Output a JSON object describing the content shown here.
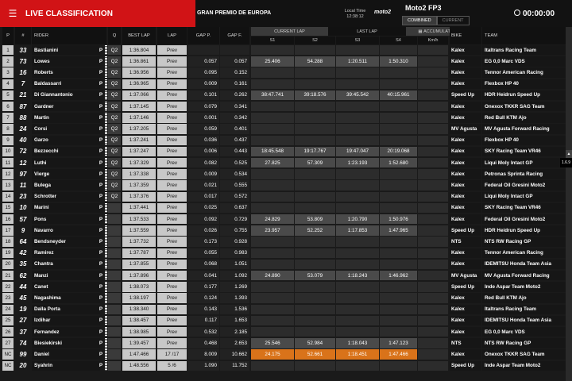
{
  "header": {
    "title": "LIVE CLASSIFICATION",
    "event": "GRAN PREMIO DE EUROPA",
    "local_time_label": "Local Time",
    "local_time": "12:38:12",
    "logo": "moto2",
    "session": "Moto2 FP3",
    "seg_combined": "COMBINED",
    "seg_current": "CURRENT",
    "clock": "00:00:00"
  },
  "columns": {
    "p": "P",
    "num": "#",
    "rider": "RIDER",
    "q": "Q",
    "best": "BEST LAP",
    "lap": "LAP",
    "gapp": "GAP P.",
    "gapf": "GAP F.",
    "current_lap": "CURRENT LAP",
    "last_lap": "LAST LAP",
    "accumulated": "ACCUMULATED",
    "s1": "S1",
    "s2": "S2",
    "s3": "S3",
    "s4": "S4",
    "kmh": "Km/h",
    "bike": "BIKE",
    "team": "TEAM"
  },
  "version": "1.6.9",
  "rows": [
    {
      "pos": "1",
      "num": "33",
      "rider": "Bastianini",
      "flag": "P",
      "q": "Q2",
      "best": "1:36.804",
      "lap": "Prev",
      "gapp": "",
      "gapf": "",
      "s1": "",
      "s2": "",
      "s3": "",
      "s4": "",
      "bike": "Kalex",
      "team": "Italtrans Racing Team",
      "style": ""
    },
    {
      "pos": "2",
      "num": "73",
      "rider": "Lowes",
      "flag": "P",
      "q": "Q2",
      "best": "1:36.861",
      "lap": "Prev",
      "gapp": "0.057",
      "gapf": "0.057",
      "s1": "25.406",
      "s2": "54.288",
      "s3": "1:20.511",
      "s4": "1:50.310",
      "bike": "Kalex",
      "team": "EG 0,0 Marc VDS",
      "style": "hl"
    },
    {
      "pos": "3",
      "num": "16",
      "rider": "Roberts",
      "flag": "P",
      "q": "Q2",
      "best": "1:36.956",
      "lap": "Prev",
      "gapp": "0.095",
      "gapf": "0.152",
      "s1": "",
      "s2": "",
      "s3": "",
      "s4": "",
      "bike": "Kalex",
      "team": "Tennor American Racing",
      "style": ""
    },
    {
      "pos": "4",
      "num": "7",
      "rider": "Baldassarri",
      "flag": "P",
      "q": "Q2",
      "best": "1:36.965",
      "lap": "Prev",
      "gapp": "0.009",
      "gapf": "0.161",
      "s1": "",
      "s2": "",
      "s3": "",
      "s4": "",
      "bike": "Kalex",
      "team": "Flexbox HP 40",
      "style": ""
    },
    {
      "pos": "5",
      "num": "21",
      "rider": "Di Giannantonio",
      "flag": "P",
      "q": "Q2",
      "best": "1:37.066",
      "lap": "Prev",
      "gapp": "0.101",
      "gapf": "0.262",
      "s1": "38:47.741",
      "s2": "39:18.576",
      "s3": "39:45.542",
      "s4": "40:15.961",
      "bike": "Speed Up",
      "team": "HDR Heidrun Speed Up",
      "style": "hl"
    },
    {
      "pos": "6",
      "num": "87",
      "rider": "Gardner",
      "flag": "P",
      "q": "Q2",
      "best": "1:37.145",
      "lap": "Prev",
      "gapp": "0.079",
      "gapf": "0.341",
      "s1": "",
      "s2": "",
      "s3": "",
      "s4": "",
      "bike": "Kalex",
      "team": "Onexox TKKR SAG Team",
      "style": ""
    },
    {
      "pos": "7",
      "num": "88",
      "rider": "Martin",
      "flag": "P",
      "q": "Q2",
      "best": "1:37.146",
      "lap": "Prev",
      "gapp": "0.001",
      "gapf": "0.342",
      "s1": "",
      "s2": "",
      "s3": "",
      "s4": "",
      "bike": "Kalex",
      "team": "Red Bull KTM Ajo",
      "style": ""
    },
    {
      "pos": "8",
      "num": "24",
      "rider": "Corsi",
      "flag": "P",
      "q": "Q2",
      "best": "1:37.205",
      "lap": "Prev",
      "gapp": "0.059",
      "gapf": "0.401",
      "s1": "",
      "s2": "",
      "s3": "",
      "s4": "",
      "bike": "MV Agusta",
      "team": "MV Agusta Forward Racing",
      "style": ""
    },
    {
      "pos": "9",
      "num": "40",
      "rider": "Garzo",
      "flag": "P",
      "q": "Q2",
      "best": "1:37.241",
      "lap": "Prev",
      "gapp": "0.036",
      "gapf": "0.437",
      "s1": "",
      "s2": "",
      "s3": "",
      "s4": "",
      "bike": "Kalex",
      "team": "Flexbox HP 40",
      "style": ""
    },
    {
      "pos": "10",
      "num": "72",
      "rider": "Bezzecchi",
      "flag": "P",
      "q": "Q2",
      "best": "1:37.247",
      "lap": "Prev",
      "gapp": "0.006",
      "gapf": "0.443",
      "s1": "18:45.548",
      "s2": "19:17.767",
      "s3": "19:47.047",
      "s4": "20:19.068",
      "bike": "Kalex",
      "team": "SKY Racing Team VR46",
      "style": "hl"
    },
    {
      "pos": "11",
      "num": "12",
      "rider": "Luthi",
      "flag": "P",
      "q": "Q2",
      "best": "1:37.329",
      "lap": "Prev",
      "gapp": "0.082",
      "gapf": "0.525",
      "s1": "27.825",
      "s2": "57.309",
      "s3": "1:23.193",
      "s4": "1:52.680",
      "bike": "Kalex",
      "team": "Liqui Moly Intact GP",
      "style": "hl"
    },
    {
      "pos": "12",
      "num": "97",
      "rider": "Vierge",
      "flag": "P",
      "q": "Q2",
      "best": "1:37.338",
      "lap": "Prev",
      "gapp": "0.009",
      "gapf": "0.534",
      "s1": "",
      "s2": "",
      "s3": "",
      "s4": "",
      "bike": "Kalex",
      "team": "Petronas Sprinta Racing",
      "style": ""
    },
    {
      "pos": "13",
      "num": "11",
      "rider": "Bulega",
      "flag": "P",
      "q": "Q2",
      "best": "1:37.359",
      "lap": "Prev",
      "gapp": "0.021",
      "gapf": "0.555",
      "s1": "",
      "s2": "",
      "s3": "",
      "s4": "",
      "bike": "Kalex",
      "team": "Federal Oil Gresini Moto2",
      "style": ""
    },
    {
      "pos": "14",
      "num": "23",
      "rider": "Schrotter",
      "flag": "P",
      "q": "Q2",
      "best": "1:37.376",
      "lap": "Prev",
      "gapp": "0.017",
      "gapf": "0.572",
      "s1": "",
      "s2": "",
      "s3": "",
      "s4": "",
      "bike": "Kalex",
      "team": "Liqui Moly Intact GP",
      "style": ""
    },
    {
      "pos": "15",
      "num": "10",
      "rider": "Marini",
      "flag": "P",
      "q": "",
      "best": "1:37.441",
      "lap": "Prev",
      "gapp": "0.025",
      "gapf": "0.637",
      "s1": "",
      "s2": "",
      "s3": "",
      "s4": "",
      "bike": "Kalex",
      "team": "SKY Racing Team VR46",
      "style": ""
    },
    {
      "pos": "16",
      "num": "57",
      "rider": "Pons",
      "flag": "P",
      "q": "",
      "best": "1:37.533",
      "lap": "Prev",
      "gapp": "0.092",
      "gapf": "0.729",
      "s1": "24.829",
      "s2": "53.809",
      "s3": "1:20.790",
      "s4": "1:50.976",
      "bike": "Kalex",
      "team": "Federal Oil Gresini Moto2",
      "style": "hl"
    },
    {
      "pos": "17",
      "num": "9",
      "rider": "Navarro",
      "flag": "P",
      "q": "",
      "best": "1:37.559",
      "lap": "Prev",
      "gapp": "0.026",
      "gapf": "0.755",
      "s1": "23.957",
      "s2": "52.252",
      "s3": "1:17.853",
      "s4": "1:47.965",
      "bike": "Speed Up",
      "team": "HDR Heidrun Speed Up",
      "style": "hl"
    },
    {
      "pos": "18",
      "num": "64",
      "rider": "Bendsneyder",
      "flag": "P",
      "q": "",
      "best": "1:37.732",
      "lap": "Prev",
      "gapp": "0.173",
      "gapf": "0.928",
      "s1": "",
      "s2": "",
      "s3": "",
      "s4": "",
      "bike": "NTS",
      "team": "NTS RW Racing GP",
      "style": ""
    },
    {
      "pos": "19",
      "num": "42",
      "rider": "Ramirez",
      "flag": "P",
      "q": "",
      "best": "1:37.787",
      "lap": "Prev",
      "gapp": "0.055",
      "gapf": "0.983",
      "s1": "",
      "s2": "",
      "s3": "",
      "s4": "",
      "bike": "Kalex",
      "team": "Tennor American Racing",
      "style": ""
    },
    {
      "pos": "20",
      "num": "35",
      "rider": "Chantra",
      "flag": "P",
      "q": "",
      "best": "1:37.855",
      "lap": "Prev",
      "gapp": "0.068",
      "gapf": "1.051",
      "s1": "",
      "s2": "",
      "s3": "",
      "s4": "",
      "bike": "Kalex",
      "team": "IDEMITSU Honda Team Asia",
      "style": ""
    },
    {
      "pos": "21",
      "num": "62",
      "rider": "Manzi",
      "flag": "P",
      "q": "",
      "best": "1:37.896",
      "lap": "Prev",
      "gapp": "0.041",
      "gapf": "1.092",
      "s1": "24.890",
      "s2": "53.079",
      "s3": "1:18.243",
      "s4": "1:46.962",
      "bike": "MV Agusta",
      "team": "MV Agusta Forward Racing",
      "style": "hl"
    },
    {
      "pos": "22",
      "num": "44",
      "rider": "Canet",
      "flag": "P",
      "q": "",
      "best": "1:38.073",
      "lap": "Prev",
      "gapp": "0.177",
      "gapf": "1.269",
      "s1": "",
      "s2": "",
      "s3": "",
      "s4": "",
      "bike": "Speed Up",
      "team": "Inde Aspar Team Moto2",
      "style": ""
    },
    {
      "pos": "23",
      "num": "45",
      "rider": "Nagashima",
      "flag": "P",
      "q": "",
      "best": "1:38.197",
      "lap": "Prev",
      "gapp": "0.124",
      "gapf": "1.393",
      "s1": "",
      "s2": "",
      "s3": "",
      "s4": "",
      "bike": "Kalex",
      "team": "Red Bull KTM Ajo",
      "style": ""
    },
    {
      "pos": "24",
      "num": "19",
      "rider": "Dalla Porta",
      "flag": "P",
      "q": "",
      "best": "1:38.340",
      "lap": "Prev",
      "gapp": "0.143",
      "gapf": "1.536",
      "s1": "",
      "s2": "",
      "s3": "",
      "s4": "",
      "bike": "Kalex",
      "team": "Italtrans Racing Team",
      "style": ""
    },
    {
      "pos": "25",
      "num": "27",
      "rider": "Izdihar",
      "flag": "P",
      "q": "",
      "best": "1:38.457",
      "lap": "Prev",
      "gapp": "0.117",
      "gapf": "1.653",
      "s1": "",
      "s2": "",
      "s3": "",
      "s4": "",
      "bike": "Kalex",
      "team": "IDEMITSU Honda Team Asia",
      "style": ""
    },
    {
      "pos": "26",
      "num": "37",
      "rider": "Fernandez",
      "flag": "P",
      "q": "",
      "best": "1:38.985",
      "lap": "Prev",
      "gapp": "0.532",
      "gapf": "2.185",
      "s1": "",
      "s2": "",
      "s3": "",
      "s4": "",
      "bike": "Kalex",
      "team": "EG 0,0 Marc VDS",
      "style": ""
    },
    {
      "pos": "27",
      "num": "74",
      "rider": "Biesiekirski",
      "flag": "P",
      "q": "",
      "best": "1:39.457",
      "lap": "Prev",
      "gapp": "0.468",
      "gapf": "2.653",
      "s1": "25.546",
      "s2": "52.984",
      "s3": "1:18.043",
      "s4": "1:47.123",
      "bike": "NTS",
      "team": "NTS RW Racing GP",
      "style": "hl"
    },
    {
      "pos": "NC",
      "num": "99",
      "rider": "Daniel",
      "flag": "P",
      "q": "",
      "best": "1:47.466",
      "lap": "17 /17",
      "gapp": "8.009",
      "gapf": "10.662",
      "s1": "24.175",
      "s2": "52.661",
      "s3": "1:18.451",
      "s4": "1:47.466",
      "bike": "Kalex",
      "team": "Onexox TKKR SAG Team",
      "style": "orange"
    },
    {
      "pos": "NC",
      "num": "20",
      "rider": "Syahrin",
      "flag": "P",
      "q": "",
      "best": "1:48.556",
      "lap": "5 /6",
      "gapp": "1.090",
      "gapf": "11.752",
      "s1": "",
      "s2": "",
      "s3": "",
      "s4": "",
      "bike": "Speed Up",
      "team": "Inde Aspar Team Moto2",
      "style": ""
    }
  ]
}
